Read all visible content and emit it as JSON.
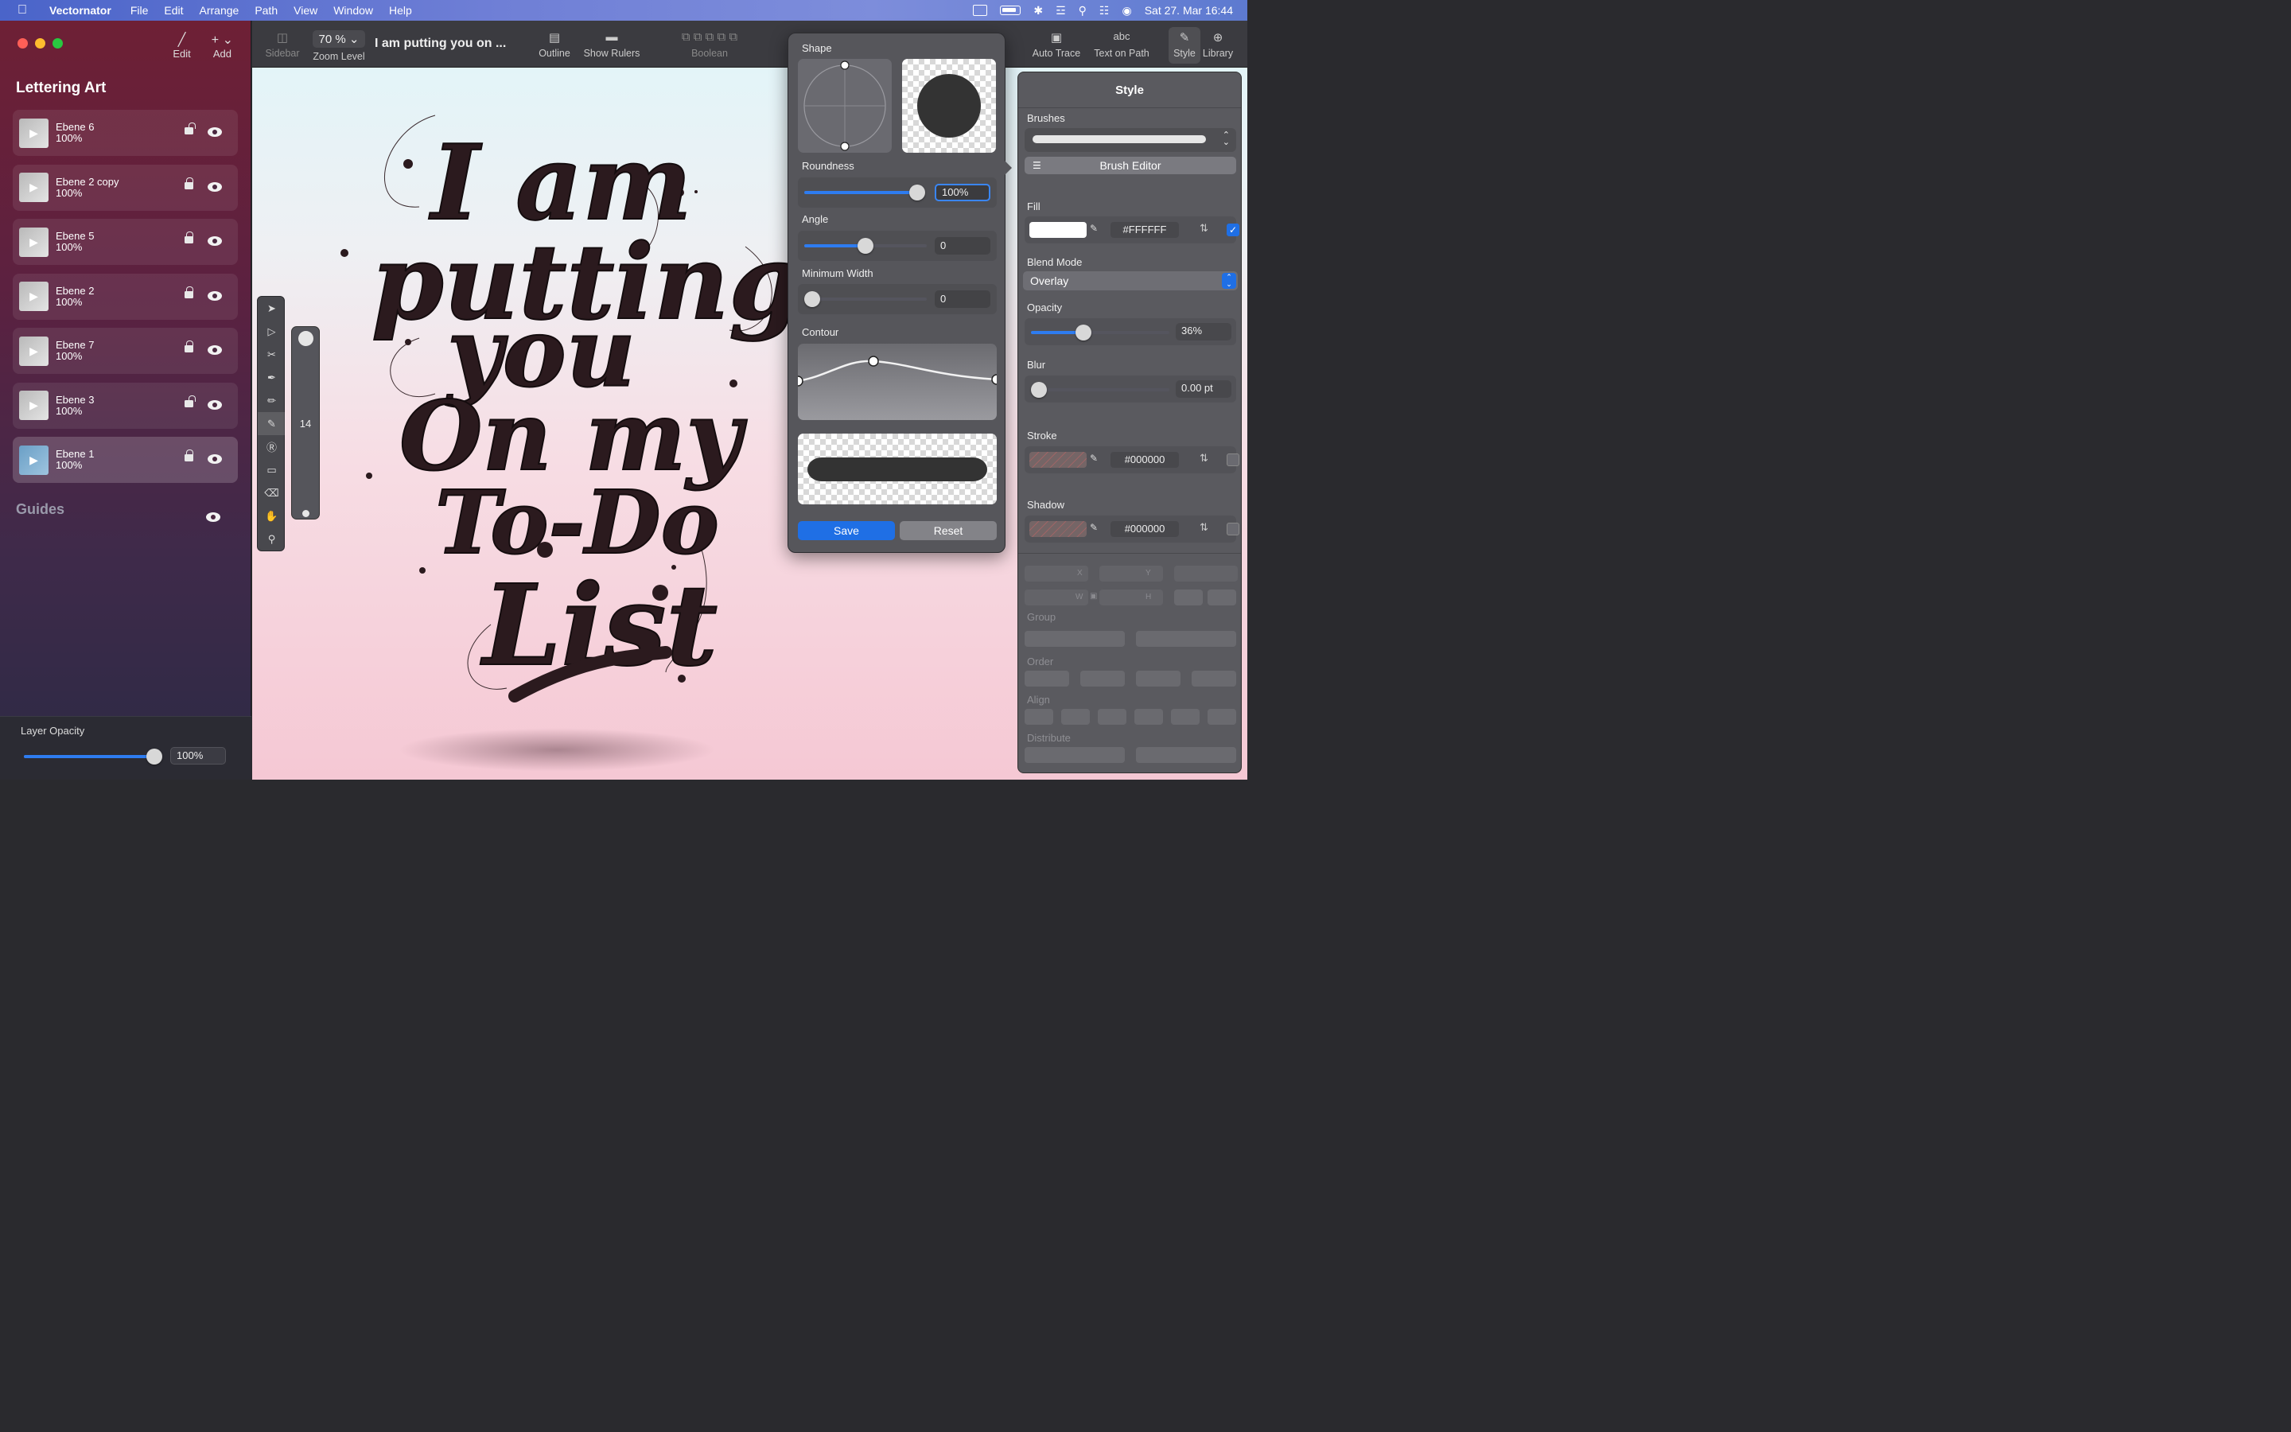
{
  "menubar": {
    "app_name": "Vectornator",
    "menus": [
      "File",
      "Edit",
      "Arrange",
      "Path",
      "View",
      "Window",
      "Help"
    ],
    "clock": "Sat 27. Mar  16:44"
  },
  "sidebar": {
    "tools": [
      {
        "label": "Edit",
        "icon": "pencil-icon"
      },
      {
        "label": "Add",
        "icon": "plus-icon"
      }
    ],
    "title": "Lettering Art",
    "layers": [
      {
        "name": "Ebene 6",
        "opacity": "100%",
        "locked": false,
        "selected": false
      },
      {
        "name": "Ebene 2 copy",
        "opacity": "100%",
        "locked": true,
        "selected": false
      },
      {
        "name": "Ebene 5",
        "opacity": "100%",
        "locked": true,
        "selected": false
      },
      {
        "name": "Ebene 2",
        "opacity": "100%",
        "locked": true,
        "selected": false
      },
      {
        "name": "Ebene 7",
        "opacity": "100%",
        "locked": true,
        "selected": false
      },
      {
        "name": "Ebene 3",
        "opacity": "100%",
        "locked": false,
        "selected": false
      },
      {
        "name": "Ebene 1",
        "opacity": "100%",
        "locked": true,
        "selected": true
      }
    ],
    "guides_label": "Guides",
    "layer_opacity": {
      "label": "Layer Opacity",
      "value": "100%",
      "fraction": 1.0
    }
  },
  "toolbar": {
    "sidebar_label": "Sidebar",
    "zoom_value": "70 %",
    "zoom_label": "Zoom Level",
    "document_title": "I am putting you on ...",
    "outline_label": "Outline",
    "rulers_label": "Show Rulers",
    "boolean_label": "Boolean",
    "autotrace_label": "Auto Trace",
    "textpath_label": "Text on Path",
    "textpath_glyph": "abc",
    "style_label": "Style",
    "library_label": "Library"
  },
  "canvas": {
    "lettering": [
      "I am",
      "putting",
      "you",
      "On my",
      "To-Do",
      "List"
    ],
    "brush_size": "14"
  },
  "brush_editor": {
    "shape_label": "Shape",
    "roundness_label": "Roundness",
    "roundness_value": "100%",
    "roundness_fraction": 1.0,
    "angle_label": "Angle",
    "angle_value": "0",
    "angle_fraction": 0.5,
    "min_width_label": "Minimum Width",
    "min_width_value": "0",
    "min_width_fraction": 0.0,
    "contour_label": "Contour",
    "save_label": "Save",
    "reset_label": "Reset"
  },
  "style_panel": {
    "title": "Style",
    "brushes_label": "Brushes",
    "brush_editor_label": "Brush Editor",
    "fill_label": "Fill",
    "fill_hex": "#FFFFFF",
    "fill_enabled": true,
    "blend_label": "Blend Mode",
    "blend_value": "Overlay",
    "opacity_label": "Opacity",
    "opacity_value": "36%",
    "opacity_fraction": 0.36,
    "blur_label": "Blur",
    "blur_value": "0.00 pt",
    "stroke_label": "Stroke",
    "stroke_hex": "#000000",
    "shadow_label": "Shadow",
    "shadow_hex": "#000000",
    "geometry_labels": {
      "x": "X",
      "y": "Y",
      "w": "W",
      "h": "H"
    },
    "group_label": "Group",
    "order_label": "Order",
    "align_label": "Align",
    "distribute_label": "Distribute"
  },
  "colors": {
    "accent": "#1f6fe5",
    "lettering": "#2b1a1e"
  }
}
